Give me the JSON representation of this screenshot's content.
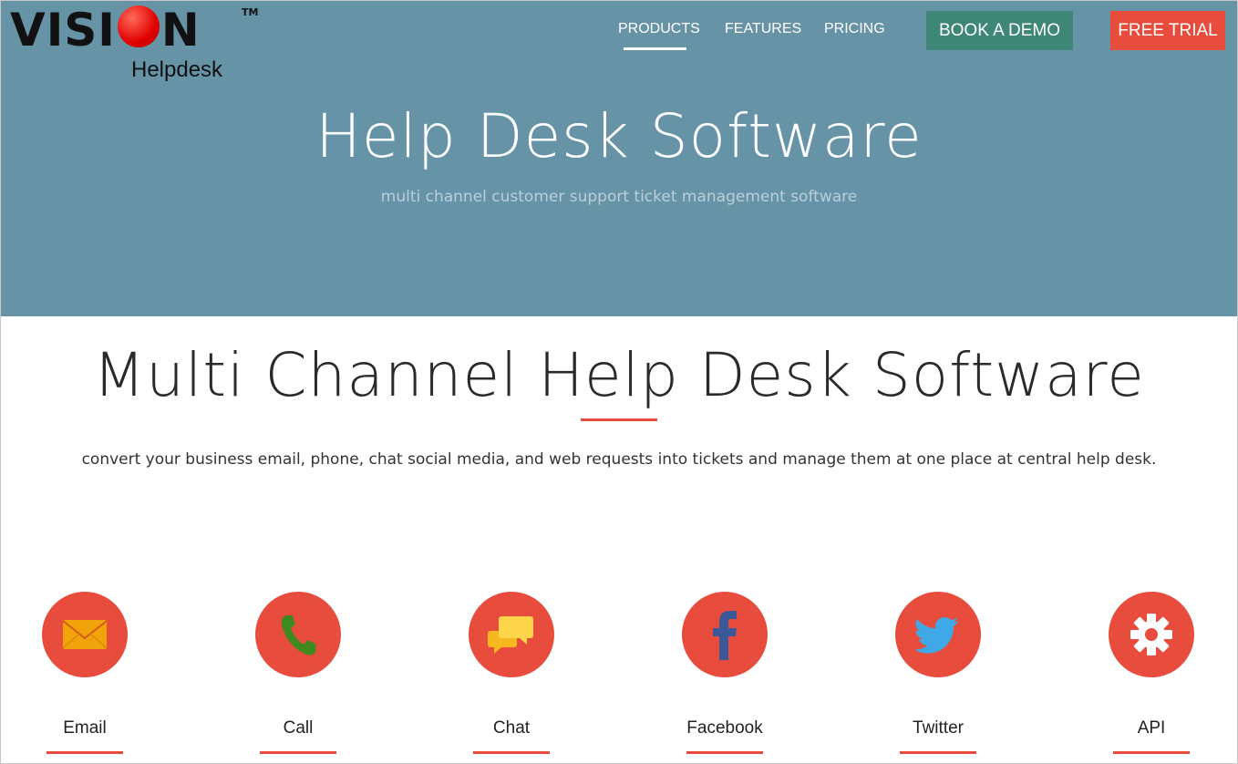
{
  "brand": {
    "name": "VISION",
    "sub": "Helpdesk",
    "tm": "TM"
  },
  "nav": {
    "products": "PRODUCTS",
    "features": "FEATURES",
    "pricing": "PRICING"
  },
  "buttons": {
    "demo": "BOOK A DEMO",
    "trial": "FREE TRIAL"
  },
  "hero": {
    "title": "Help Desk Software",
    "subtitle": "multi channel customer support ticket management software"
  },
  "section": {
    "title": "Multi Channel Help Desk Software",
    "description": "convert your business email, phone, chat social media, and web requests into tickets and manage them at one place at central help desk."
  },
  "channels": [
    {
      "label": "Email",
      "icon": "envelope-icon"
    },
    {
      "label": "Call",
      "icon": "phone-icon"
    },
    {
      "label": "Chat",
      "icon": "chat-icon"
    },
    {
      "label": "Facebook",
      "icon": "facebook-icon"
    },
    {
      "label": "Twitter",
      "icon": "twitter-icon"
    },
    {
      "label": "API",
      "icon": "gear-icon"
    }
  ],
  "colors": {
    "hero": "#6793a7",
    "accent": "#e74c3c",
    "demo": "#3e8676"
  }
}
